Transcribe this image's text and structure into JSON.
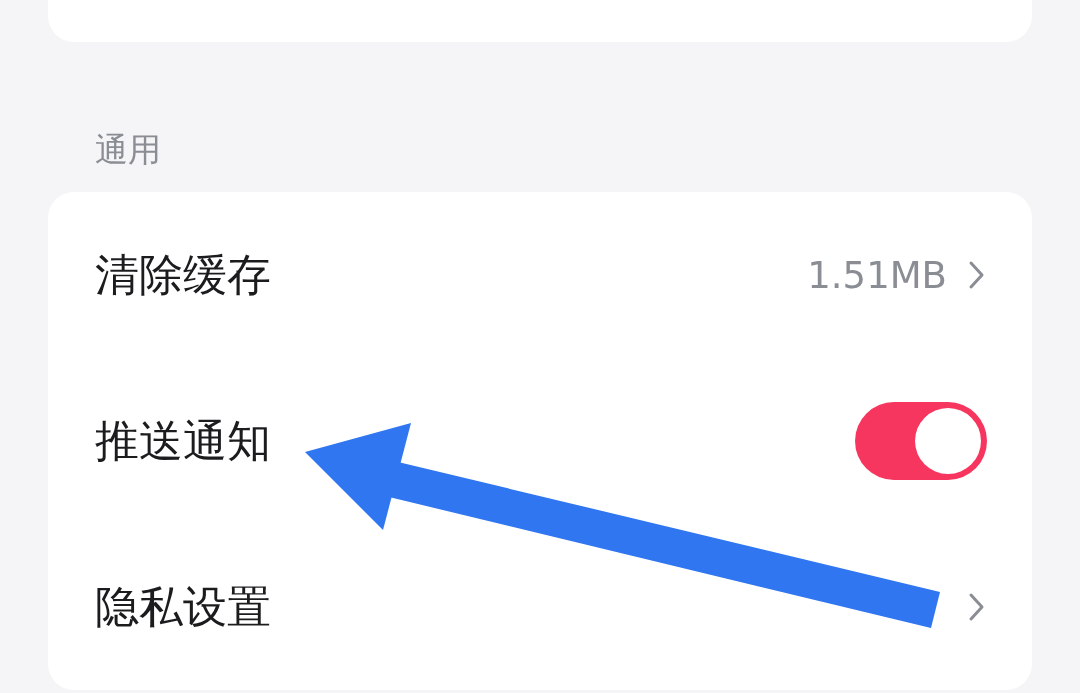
{
  "section": {
    "title": "通用"
  },
  "rows": [
    {
      "kind": "value",
      "label": "清除缓存",
      "value": "1.51MB"
    },
    {
      "kind": "toggle",
      "label": "推送通知",
      "on": true
    },
    {
      "kind": "link",
      "label": "隐私设置"
    }
  ]
}
